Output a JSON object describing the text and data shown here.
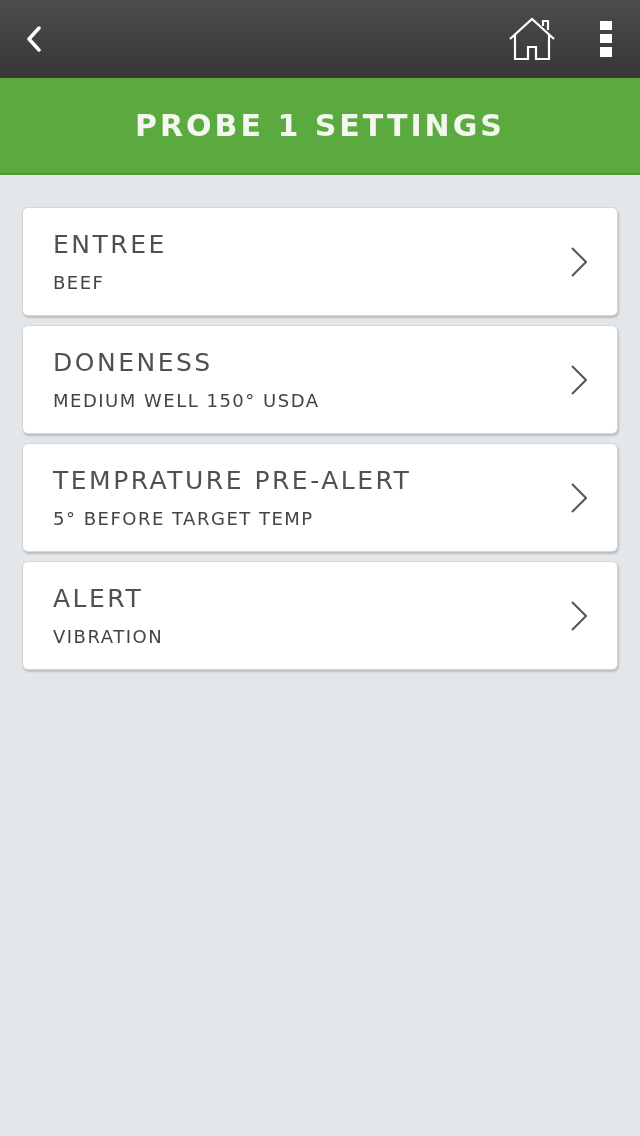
{
  "header": {
    "title": "PROBE 1 SETTINGS"
  },
  "settings": [
    {
      "label": "ENTREE",
      "value": "BEEF"
    },
    {
      "label": "DONENESS",
      "value": "MEDIUM WELL 150° USDA"
    },
    {
      "label": "TEMPRATURE PRE-ALERT",
      "value": "5° BEFORE TARGET TEMP"
    },
    {
      "label": "ALERT",
      "value": "VIBRATION"
    }
  ]
}
